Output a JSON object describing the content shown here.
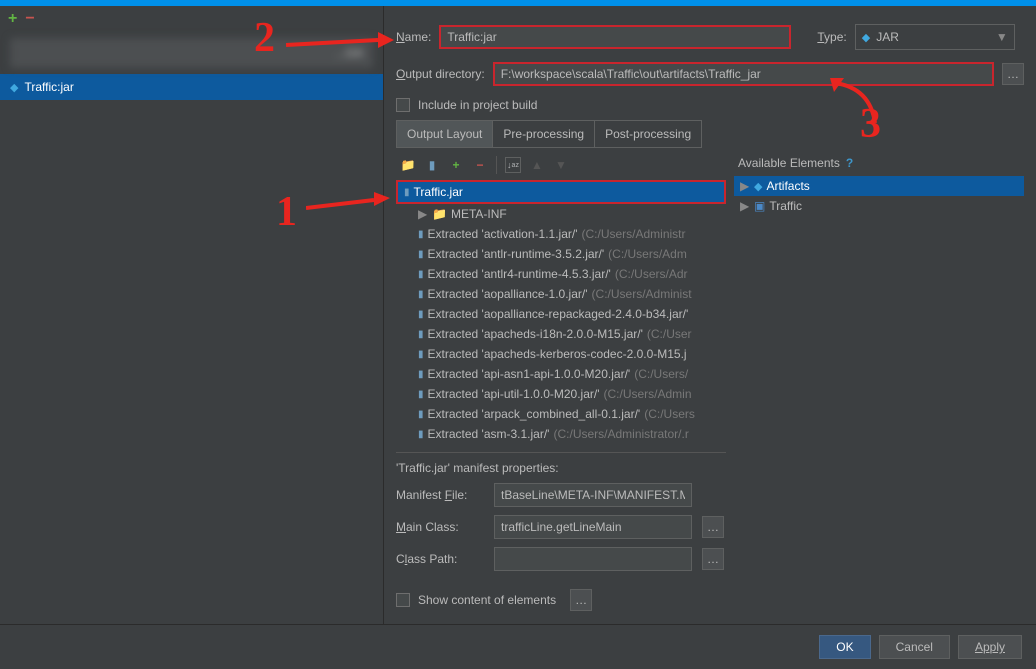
{
  "sidebar": {
    "blur_text": "...GA",
    "selected": "Traffic:jar"
  },
  "form": {
    "name_label": "Name:",
    "name_value": "Traffic:jar",
    "type_label": "Type:",
    "type_value": "JAR",
    "outdir_label": "Output directory:",
    "outdir_value": "F:\\workspace\\scala\\Traffic\\out\\artifacts\\Traffic_jar",
    "include_label": "Include in project build"
  },
  "tabs": {
    "t1": "Output Layout",
    "t2": "Pre-processing",
    "t3": "Post-processing"
  },
  "tree": {
    "root": "Traffic.jar",
    "metainf": "META-INF",
    "items": [
      {
        "text": "Extracted 'activation-1.1.jar/'",
        "path": "(C:/Users/Administr"
      },
      {
        "text": "Extracted 'antlr-runtime-3.5.2.jar/'",
        "path": "(C:/Users/Adm"
      },
      {
        "text": "Extracted 'antlr4-runtime-4.5.3.jar/'",
        "path": "(C:/Users/Adr"
      },
      {
        "text": "Extracted 'aopalliance-1.0.jar/'",
        "path": "(C:/Users/Administ"
      },
      {
        "text": "Extracted 'aopalliance-repackaged-2.4.0-b34.jar/'",
        "path": ""
      },
      {
        "text": "Extracted 'apacheds-i18n-2.0.0-M15.jar/'",
        "path": "(C:/User"
      },
      {
        "text": "Extracted 'apacheds-kerberos-codec-2.0.0-M15.j",
        "path": ""
      },
      {
        "text": "Extracted 'api-asn1-api-1.0.0-M20.jar/'",
        "path": "(C:/Users/"
      },
      {
        "text": "Extracted 'api-util-1.0.0-M20.jar/'",
        "path": "(C:/Users/Admin"
      },
      {
        "text": "Extracted 'arpack_combined_all-0.1.jar/'",
        "path": "(C:/Users"
      },
      {
        "text": "Extracted 'asm-3.1.jar/'",
        "path": "(C:/Users/Administrator/.r"
      }
    ]
  },
  "avail": {
    "header": "Available Elements",
    "items": [
      {
        "icon": "diamond",
        "text": "Artifacts"
      },
      {
        "icon": "folder",
        "text": "Traffic"
      }
    ]
  },
  "manifest": {
    "title": "'Traffic.jar' manifest properties:",
    "file_label": "Manifest File:",
    "file_value": "tBaseLine\\META-INF\\MANIFEST.MF",
    "main_label": "Main Class:",
    "main_value": "trafficLine.getLineMain",
    "cp_label": "Class Path:",
    "cp_value": "",
    "show_label": "Show content of elements"
  },
  "footer": {
    "ok": "OK",
    "cancel": "Cancel",
    "apply": "Apply"
  },
  "annotations": {
    "n1": "1",
    "n2": "2",
    "n3": "3"
  }
}
